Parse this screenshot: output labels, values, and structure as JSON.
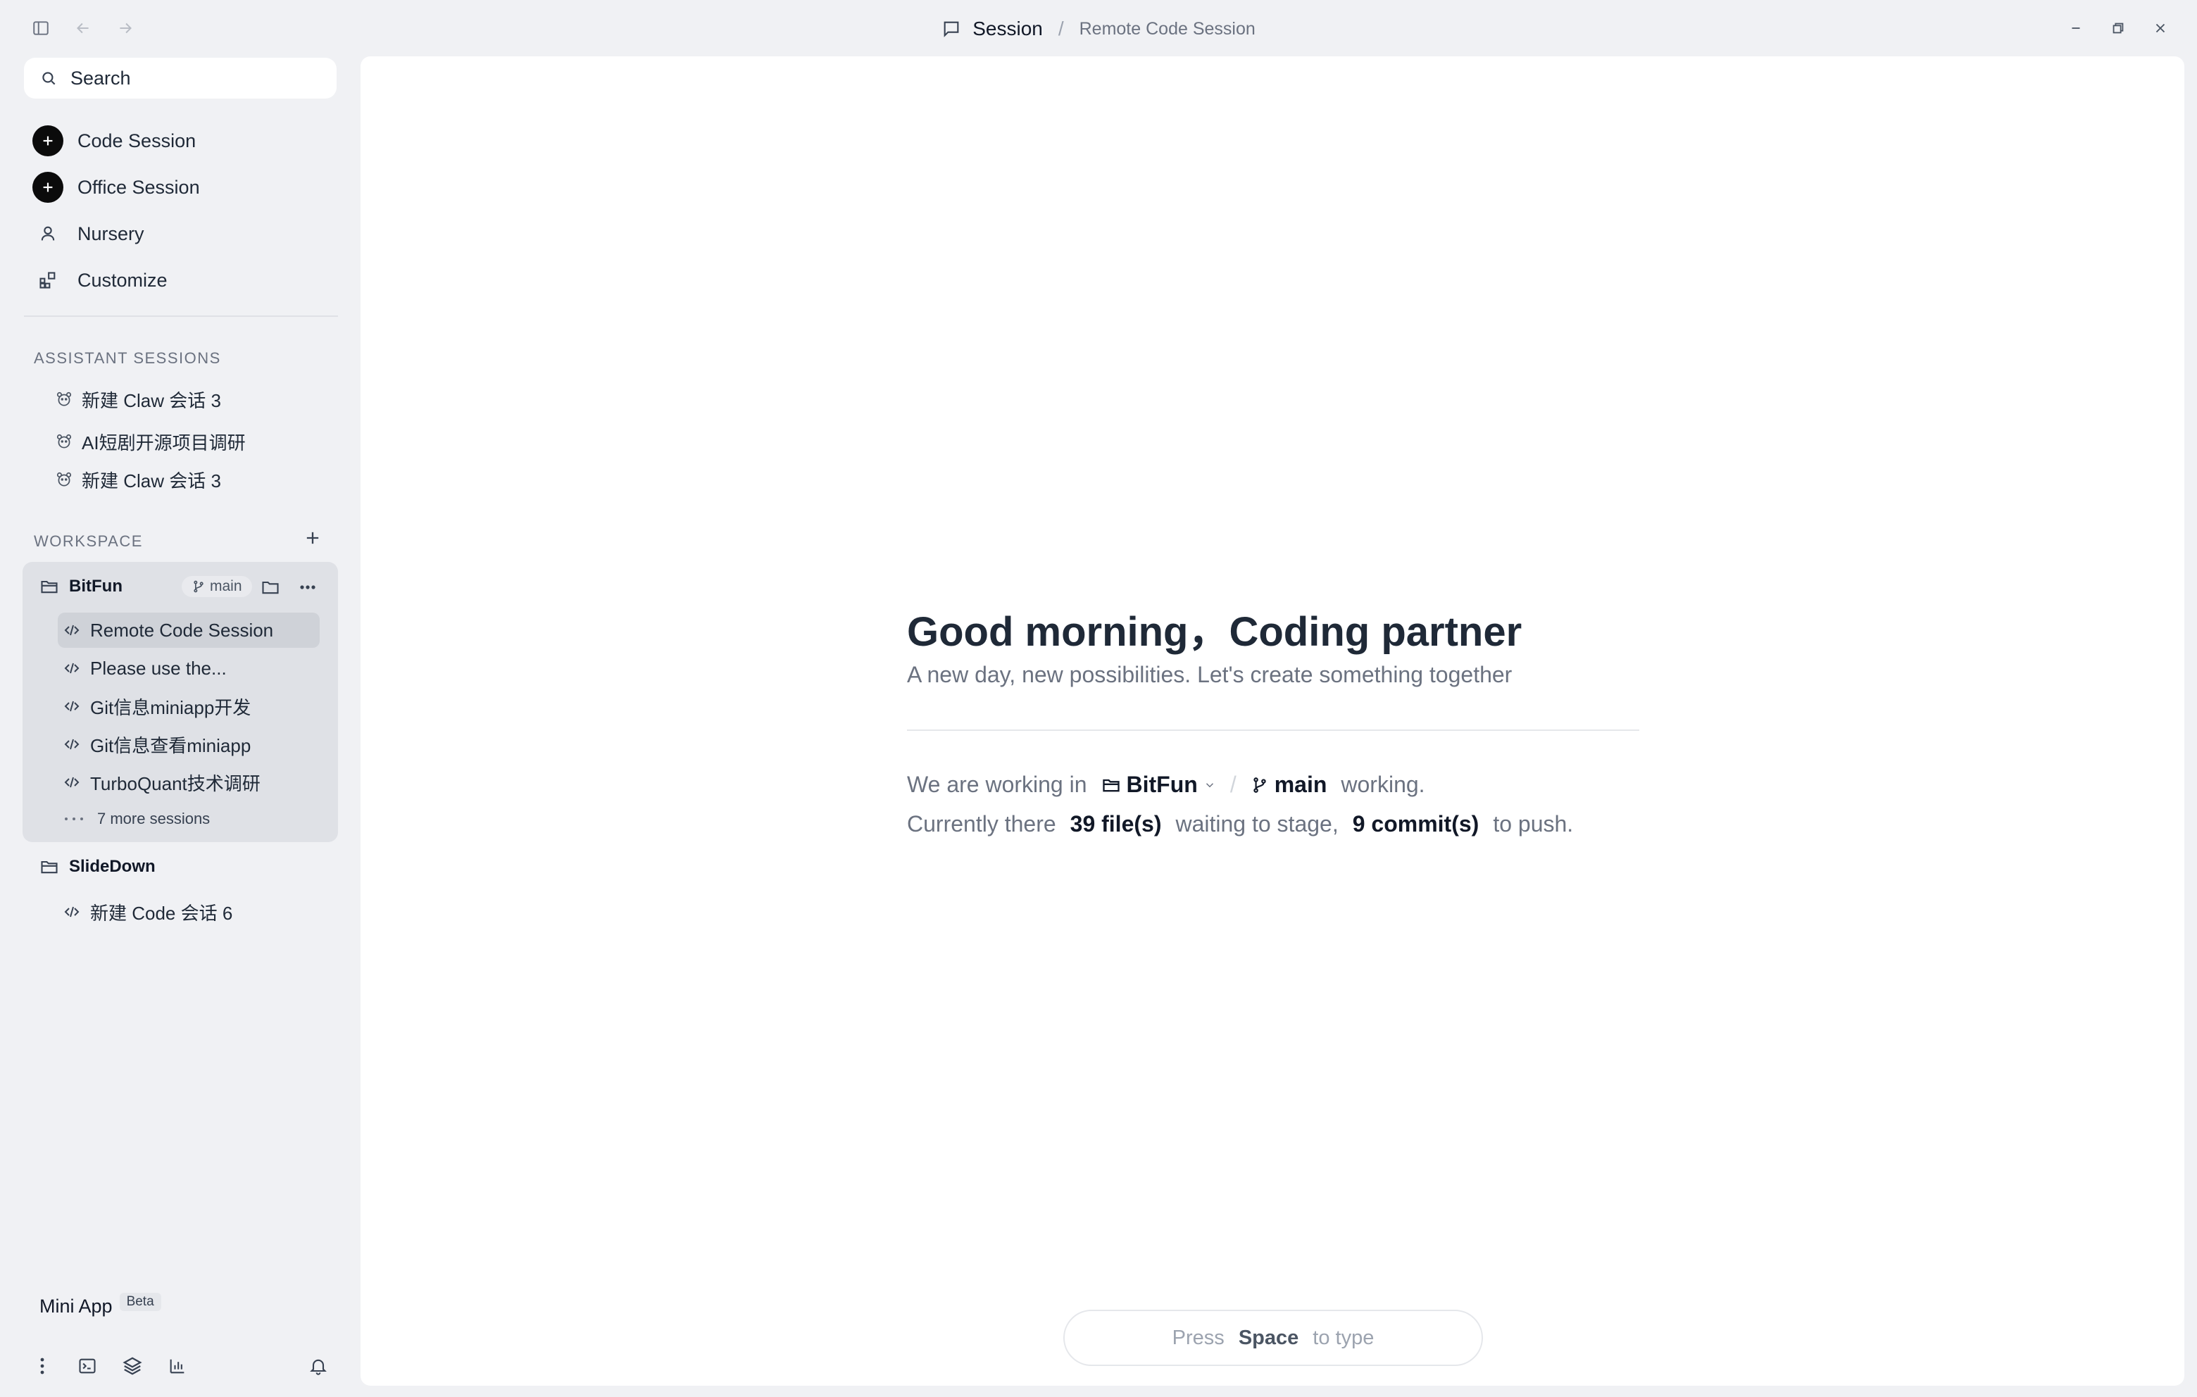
{
  "titlebar": {
    "title": "Session",
    "separator": "/",
    "subtitle": "Remote Code Session"
  },
  "sidebar": {
    "search_placeholder": "Search",
    "nav": [
      {
        "label": "Code Session",
        "icon": "plus-icon"
      },
      {
        "label": "Office Session",
        "icon": "plus-icon"
      },
      {
        "label": "Nursery",
        "icon": "user-icon"
      },
      {
        "label": "Customize",
        "icon": "widgets-icon"
      }
    ],
    "assistant_header": "ASSISTANT SESSIONS",
    "assistant_sessions": [
      {
        "label": "新建 Claw 会话 3"
      },
      {
        "label": "AI短剧开源项目调研"
      },
      {
        "label": "新建 Claw 会话 3"
      }
    ],
    "workspace_header": "WORKSPACE",
    "workspaces": [
      {
        "name": "BitFun",
        "branch": "main",
        "sessions": [
          {
            "label": "Remote Code Session",
            "active": true
          },
          {
            "label": "Please use the..."
          },
          {
            "label": "Git信息miniapp开发"
          },
          {
            "label": "Git信息查看miniapp"
          },
          {
            "label": "TurboQuant技术调研"
          }
        ],
        "more_sessions": "7 more sessions"
      },
      {
        "name": "SlideDown",
        "sessions": [
          {
            "label": "新建 Code 会话 6"
          }
        ]
      }
    ],
    "mini_app": {
      "label": "Mini App",
      "badge": "Beta"
    }
  },
  "main": {
    "greeting": "Good morning，Coding partner",
    "subtitle": "A new day, new possibilities. Let's create something together",
    "info": {
      "working_prefix": "We are working in",
      "workspace": "BitFun",
      "slash": "/",
      "branch": "main",
      "working_suffix": "working.",
      "currently": "Currently there",
      "files": "39 file(s)",
      "waiting": "waiting to stage,",
      "commits": "9 commit(s)",
      "push": "to push."
    },
    "type_hint": {
      "press": "Press",
      "key": "Space",
      "to_type": "to type"
    }
  },
  "colors": {
    "sidebar_bg": "#f0f1f4",
    "workspace_card": "#dfe1e6",
    "active_item": "#cfd2d8",
    "main_bg": "#ffffff",
    "text_primary": "#111827",
    "text_muted": "#6b7280"
  }
}
